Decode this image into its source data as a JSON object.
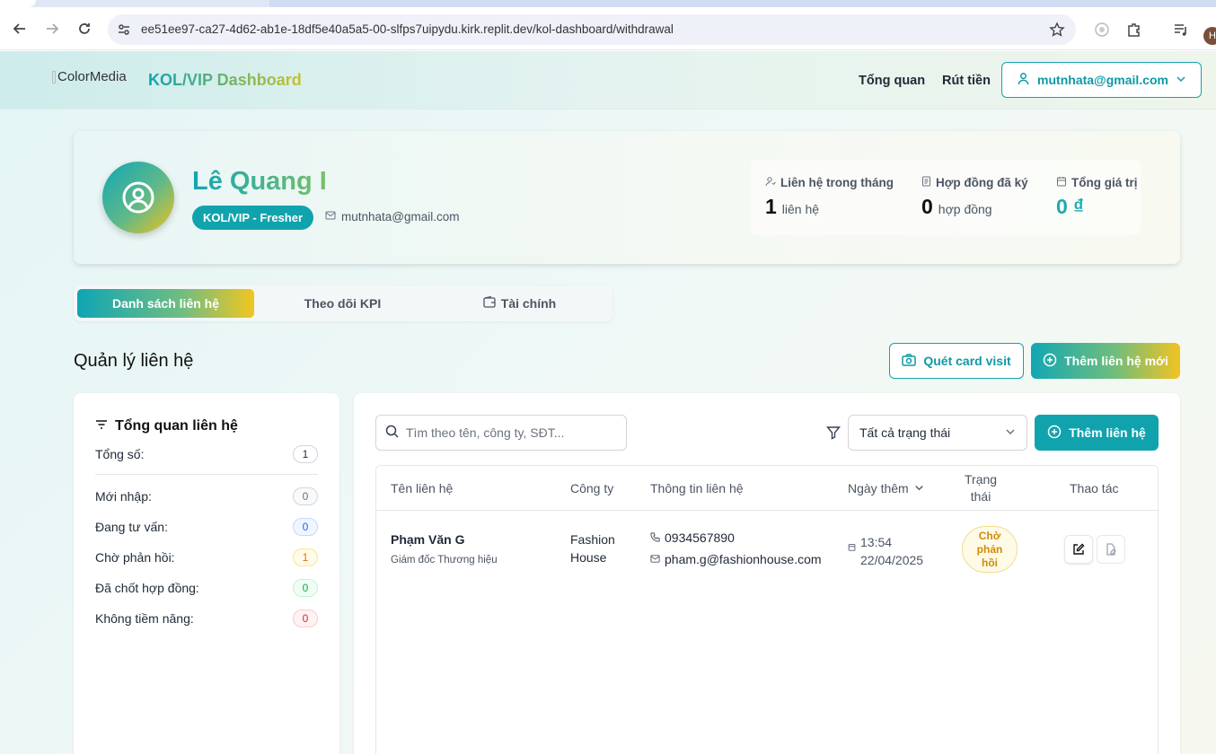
{
  "browser": {
    "url": "ee51ee97-ca27-4d62-ab1e-18df5e40a5a5-00-slfps7uipydu.kirk.replit.dev/kol-dashboard/withdrawal",
    "profile_initial": "H"
  },
  "header": {
    "logo_alt": "ColorMedia",
    "brand": "KOL/VIP Dashboard",
    "nav": [
      "Tổng quan",
      "Rút tiền"
    ],
    "user_email": "mutnhata@gmail.com"
  },
  "profile": {
    "name": "Lê Quang I",
    "role": "KOL/VIP - Fresher",
    "email": "mutnhata@gmail.com",
    "stats": [
      {
        "label": "Liên hệ trong tháng",
        "value": "1",
        "unit": "liên hệ",
        "icon": "user-check-icon"
      },
      {
        "label": "Hợp đồng đã ký",
        "value": "0",
        "unit": "hợp đồng",
        "icon": "document-icon"
      },
      {
        "label": "Tổng giá trị",
        "value": "0 ₫",
        "unit": "",
        "icon": "calendar-icon"
      }
    ]
  },
  "tabs": [
    {
      "label": "Danh sách liên hệ",
      "active": true
    },
    {
      "label": "Theo dõi KPI",
      "active": false
    },
    {
      "label": "Tài chính",
      "active": false,
      "icon": "wallet-icon"
    }
  ],
  "section": {
    "title": "Quản lý liên hệ",
    "scan_button": "Quét card visit",
    "add_new_button": "Thêm liên hệ mới"
  },
  "overview": {
    "title": "Tổng quan liên hệ",
    "total_label": "Tổng số:",
    "total_value": "1",
    "rows": [
      {
        "label": "Mới nhập:",
        "value": "0",
        "color": "#6b7280"
      },
      {
        "label": "Đang tư vấn:",
        "value": "0",
        "color": "#2563eb"
      },
      {
        "label": "Chờ phản hồi:",
        "value": "1",
        "color": "#d97706"
      },
      {
        "label": "Đã chốt hợp đồng:",
        "value": "0",
        "color": "#16a34a"
      },
      {
        "label": "Không tiềm năng:",
        "value": "0",
        "color": "#dc2626"
      }
    ]
  },
  "contacts": {
    "search_placeholder": "Tìm theo tên, công ty, SĐT...",
    "status_filter": "Tất cả trạng thái",
    "add_button": "Thêm liên hệ",
    "columns": [
      "Tên liên hệ",
      "Công ty",
      "Thông tin liên hệ",
      "Ngày thêm",
      "Trạng\nthái",
      "Thao tác"
    ],
    "rows": [
      {
        "name": "Phạm Văn G",
        "title": "Giám đốc Thương hiệu",
        "company_line1": "Fashion",
        "company_line2": "House",
        "phone": "0934567890",
        "email": "pham.g@fashionhouse.com",
        "time": "13:54",
        "date": "22/04/2025",
        "status": "Chờ\nphản\nhồi"
      }
    ]
  },
  "colors": {
    "accent": "#11a3ad",
    "gradient_start": "#0fa5b4",
    "gradient_end": "#f1c621",
    "pending": "#d08a08"
  }
}
